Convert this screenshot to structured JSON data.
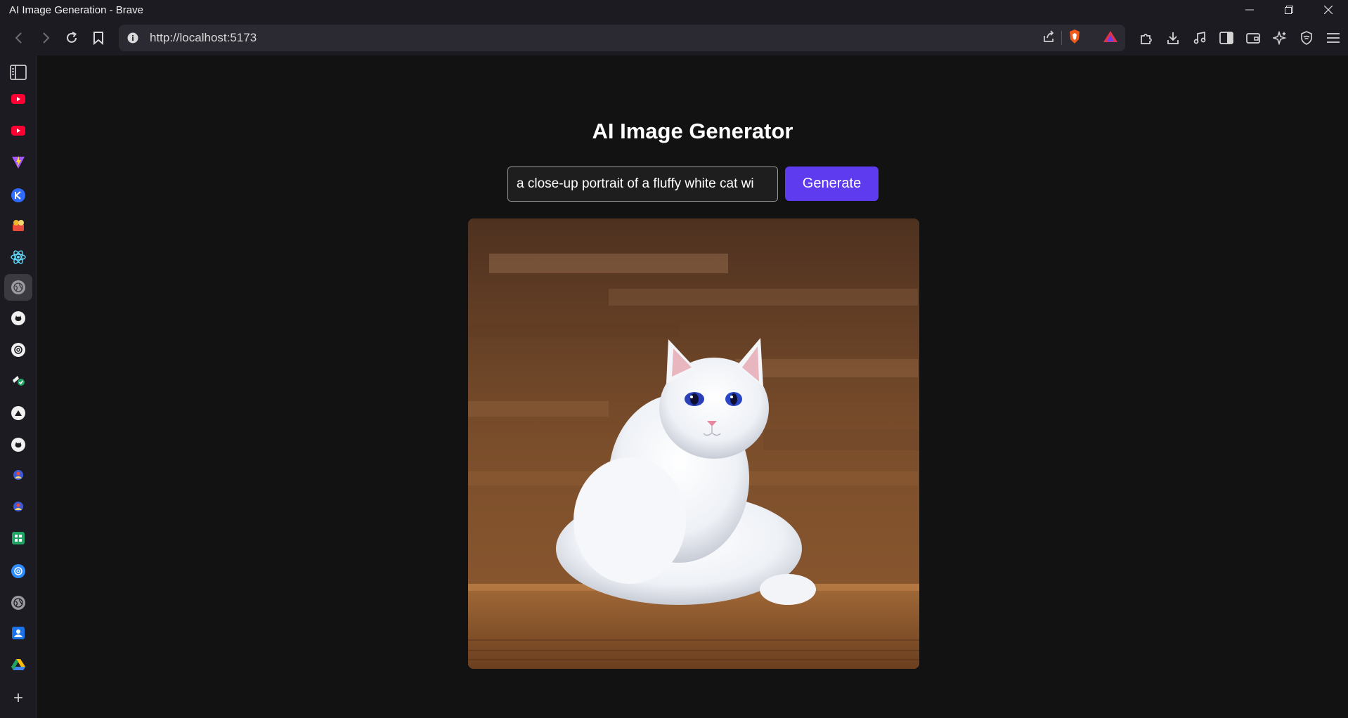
{
  "window": {
    "title": "AI Image Generation - Brave",
    "controls": [
      "minimize-icon",
      "restore-icon",
      "close-icon"
    ]
  },
  "toolbar": {
    "url": "http://localhost:5173",
    "nav_icons": [
      "back-arrow-icon",
      "forward-arrow-icon",
      "reload-icon",
      "bookmark-icon"
    ],
    "right_icons": [
      "extensions-icon",
      "download-icon",
      "music-icon",
      "sidebar-toggle-icon",
      "wallet-icon",
      "leo-ai-icon",
      "vpn-shield-icon",
      "menu-icon"
    ]
  },
  "sidebar": {
    "items": [
      {
        "icon": "panel-toggle-icon",
        "color": "#d0d0d0"
      },
      {
        "icon": "youtube-icon",
        "color": "#ff0033"
      },
      {
        "icon": "youtube-icon",
        "color": "#ff0033"
      },
      {
        "icon": "vite-icon",
        "color": "#a259ff"
      },
      {
        "icon": "kotlin-icon",
        "color": "#2f6bff"
      },
      {
        "icon": "toy-icon",
        "color": "#e84b3c"
      },
      {
        "icon": "react-icon",
        "color": "#61dafb"
      },
      {
        "icon": "globe-icon",
        "color": "#9a9aa0"
      },
      {
        "icon": "github-icon",
        "color": "#f0f0f0"
      },
      {
        "icon": "openai-icon",
        "color": "#f0f0f0"
      },
      {
        "icon": "settings-check-icon",
        "color": "#f0f0f0"
      },
      {
        "icon": "vercel-icon",
        "color": "#f0f0f0"
      },
      {
        "icon": "github-icon",
        "color": "#f0f0f0"
      },
      {
        "icon": "profile-icon",
        "color": "#3d5bd6"
      },
      {
        "icon": "profile-icon",
        "color": "#3d5bd6"
      },
      {
        "icon": "sheets-icon",
        "color": "#1fa463"
      },
      {
        "icon": "chatgpt-icon",
        "color": "#2d8cff"
      },
      {
        "icon": "globe-icon",
        "color": "#9a9aa0"
      },
      {
        "icon": "contacts-icon",
        "color": "#1a73e8"
      },
      {
        "icon": "drive-icon",
        "color": "#34a853"
      }
    ],
    "add_label": "+"
  },
  "main": {
    "title": "AI Image Generator",
    "prompt_value": "a close-up portrait of a fluffy white cat wi",
    "generate_label": "Generate"
  },
  "colors": {
    "accent": "#5f3bf0",
    "background": "#121212",
    "chrome": "#1c1b22"
  }
}
